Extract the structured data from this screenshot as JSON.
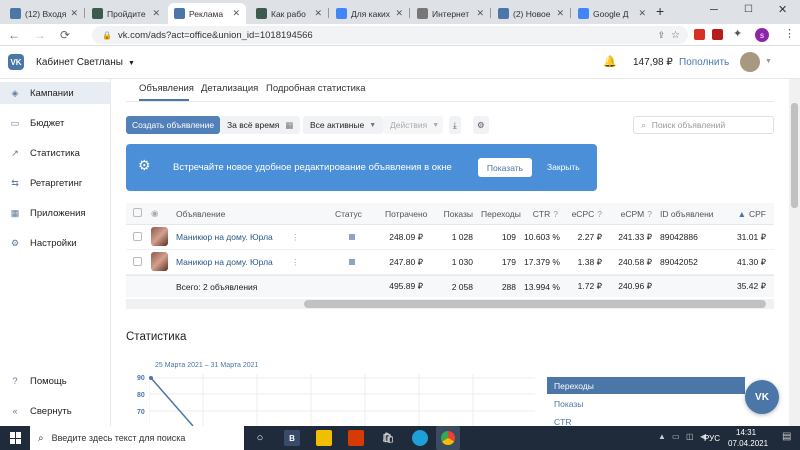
{
  "browser": {
    "tabs": [
      {
        "label": "(12) Входя",
        "icon": "mail-icon",
        "color": "#4a76a8"
      },
      {
        "label": "Пройдите",
        "icon": "gc-icon",
        "color": "#3b5b4e"
      },
      {
        "label": "Реклама",
        "icon": "vk-icon",
        "color": "#4a76a8",
        "active": true
      },
      {
        "label": "Как рабо",
        "icon": "gc-icon",
        "color": "#3b5b4e"
      },
      {
        "label": "Для каких",
        "icon": "google-icon",
        "color": "#4285f4"
      },
      {
        "label": "Интернет",
        "icon": "globe-icon",
        "color": "#777"
      },
      {
        "label": "(2) Новое",
        "icon": "vk-icon",
        "color": "#4a76a8"
      },
      {
        "label": "Google Д",
        "icon": "docs-icon",
        "color": "#4285f4"
      }
    ],
    "new_tab": "+",
    "url": "vk.com/ads?act=office&union_id=1018194566",
    "profile_initial": "s"
  },
  "header": {
    "logo": "VK",
    "account_name": "Кабинет Светланы",
    "balance": "147,98 ₽",
    "topup": "Пополнить"
  },
  "sidebar": {
    "items": [
      {
        "label": "Кампании",
        "icon": "campaigns-icon",
        "active": true
      },
      {
        "label": "Бюджет",
        "icon": "budget-icon"
      },
      {
        "label": "Статистика",
        "icon": "stats-icon"
      },
      {
        "label": "Ретаргетинг",
        "icon": "retarget-icon"
      },
      {
        "label": "Приложения",
        "icon": "apps-icon"
      },
      {
        "label": "Настройки",
        "icon": "settings-icon"
      }
    ],
    "help": "Помощь",
    "collapse": "Свернуть"
  },
  "tabs": [
    "Объявления",
    "Детализация",
    "Подробная статистика"
  ],
  "toolbar": {
    "create": "Создать объявление",
    "period": "За всё время",
    "filter": "Все активные",
    "actions": "Действия",
    "search_placeholder": "Поиск объявлений"
  },
  "banner": {
    "text": "Встречайте новое удобное редактирование объявления в окне",
    "show": "Показать",
    "close": "Закрыть"
  },
  "table": {
    "headers": [
      "Объявление",
      "Статус",
      "Потрачено",
      "Показы",
      "Переходы",
      "CTR",
      "eCPC",
      "eCPM",
      "ID объявления",
      "CPF"
    ],
    "rows": [
      {
        "name": "Маникюр на дому. Юрла",
        "spent": "248.09 ₽",
        "shows": "1 028",
        "clicks": "109",
        "ctr": "10.603 %",
        "ecpc": "2.27 ₽",
        "ecpm": "241.33 ₽",
        "id": "89042886",
        "cpf": "31.01 ₽"
      },
      {
        "name": "Маникюр на дому. Юрла",
        "spent": "247.80 ₽",
        "shows": "1 030",
        "clicks": "179",
        "ctr": "17.379 %",
        "ecpc": "1.38 ₽",
        "ecpm": "240.58 ₽",
        "id": "89042052",
        "cpf": "41.30 ₽"
      }
    ],
    "total": {
      "label": "Всего: 2 объявления",
      "spent": "495.89 ₽",
      "shows": "2 058",
      "clicks": "288",
      "ctr": "13.994 %",
      "ecpc": "1.72 ₽",
      "ecpm": "240.96 ₽",
      "cpf": "35.42 ₽"
    }
  },
  "stats": {
    "title": "Статистика",
    "range": "25 Марта 2021 – 31 Марта 2021",
    "y_ticks": [
      "90",
      "80",
      "70"
    ],
    "metrics": [
      "Переходы",
      "Показы",
      "CTR"
    ]
  },
  "taskbar": {
    "search_placeholder": "Введите здесь текст для поиска",
    "lang": "РУС",
    "time": "14:31",
    "date": "07.04.2021"
  },
  "colors": {
    "vk_blue": "#4a76a8",
    "banner": "#4a8fd8",
    "taskbar": "#1f2a3a"
  }
}
